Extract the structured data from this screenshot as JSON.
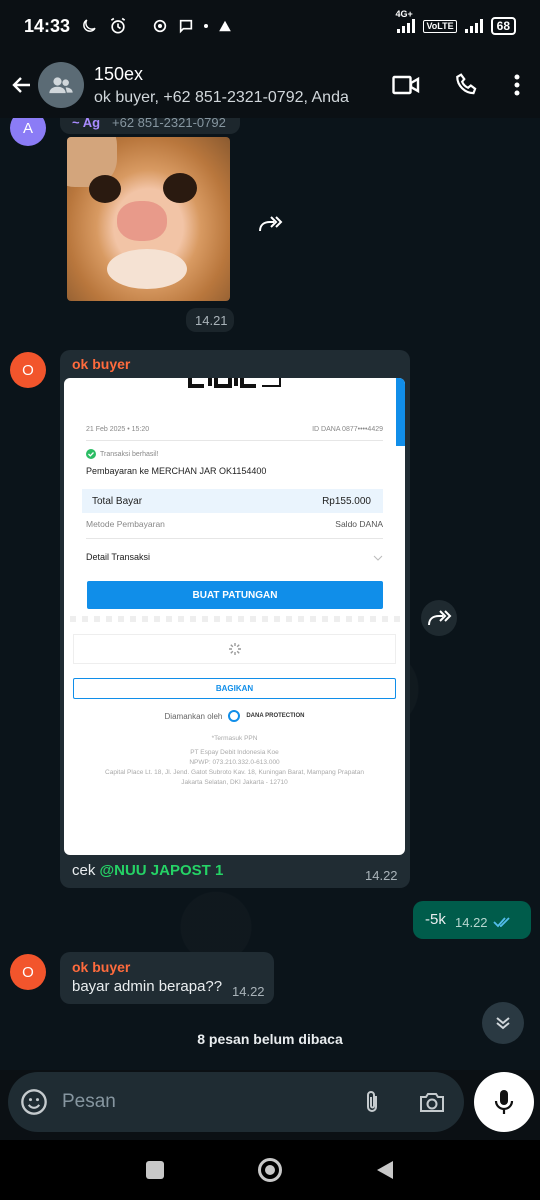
{
  "status": {
    "time": "14:33",
    "network": "4G+",
    "battery": "68",
    "volte": "VoLTE"
  },
  "header": {
    "title": "150ex",
    "subtitle": "ok buyer, +62 851-2321-0792, Anda"
  },
  "messages": [
    {
      "sender_initial": "A",
      "sender": "~ Ag",
      "sender_phone": "+62 851-2321-0792",
      "time": "14.21"
    },
    {
      "sender_initial": "O",
      "sender": "ok buyer",
      "caption_prefix": "cek",
      "caption_mention": "@NUU JAPOST 1",
      "time": "14.22",
      "receipt": {
        "date": "21 Feb 2025 • 15:20",
        "id": "ID DANA 0877••••4429",
        "status": "Transaksi berhasil!",
        "payment_to": "Pembayaran ke MERCHAN JAR OK1154400",
        "total_label": "Total Bayar",
        "total_value": "Rp155.000",
        "method_label": "Metode Pembayaran",
        "method_value": "Saldo DANA",
        "detail_label": "Detail Transaksi",
        "split_button": "BUAT PATUNGAN",
        "share_button": "BAGIKAN",
        "secured_by": "Diamankan oleh",
        "protection": "DANA PROTECTION",
        "footer": [
          "*Termasuk PPN",
          "PT Espay Debit Indonesia Koe",
          "NPWP: 073.210.332.0-613.000",
          "Capital Place Lt. 18, Jl. Jend. Gatot Subroto Kav. 18, Kuningan Barat, Mampang Prapatan",
          "Jakarta Selatan, DKI Jakarta - 12710"
        ]
      }
    },
    {
      "outgoing": true,
      "text": "-5k",
      "time": "14.22"
    },
    {
      "sender_initial": "O",
      "sender": "ok buyer",
      "text": "bayar admin berapa??",
      "time": "14.22"
    }
  ],
  "unread_label": "8 pesan belum dibaca",
  "composer": {
    "placeholder": "Pesan"
  },
  "colors": {
    "accent": "#25d366",
    "outgoing_bubble": "#005c4b",
    "incoming_bubble": "#202c33",
    "sender_ag": "#a98bff",
    "sender_okbuyer": "#ff6b3d",
    "avatar_a": "#8b7cf6",
    "avatar_o": "#f2552c",
    "dana_blue": "#108ee9"
  }
}
